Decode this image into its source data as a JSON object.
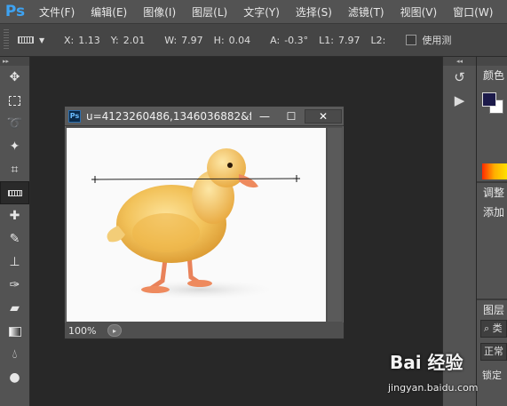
{
  "app": {
    "logo": "Ps"
  },
  "menu": {
    "items": [
      "文件(F)",
      "编辑(E)",
      "图像(I)",
      "图层(L)",
      "文字(Y)",
      "选择(S)",
      "滤镜(T)",
      "视图(V)",
      "窗口(W)"
    ]
  },
  "options": {
    "x": {
      "label": "X:",
      "value": "1.13"
    },
    "y": {
      "label": "Y:",
      "value": "2.01"
    },
    "w": {
      "label": "W:",
      "value": "7.97"
    },
    "h": {
      "label": "H:",
      "value": "0.04"
    },
    "a": {
      "label": "A:",
      "value": "-0.3°"
    },
    "l1": {
      "label": "L1:",
      "value": "7.97"
    },
    "l2": {
      "label": "L2:",
      "value": ""
    },
    "use_label": "使用测"
  },
  "document": {
    "title": "u=4123260486,1346036882&f...",
    "zoom": "100%",
    "controls": {
      "minimize": "—",
      "maximize": "☐",
      "close": "✕"
    }
  },
  "panels": {
    "color_label": "颜色",
    "adjust_label": "调整",
    "adjust_sub": "添加",
    "layers_label": "图层",
    "layers_search": "类",
    "blend_mode": "正常",
    "lock_label": "锁定"
  },
  "watermark": {
    "brand": "Bai 经验",
    "url": "jingyan.baidu.com"
  },
  "colors": {
    "foreground": "#1c1a4a",
    "background": "#ffffff",
    "accent": "#3ea3f2"
  }
}
